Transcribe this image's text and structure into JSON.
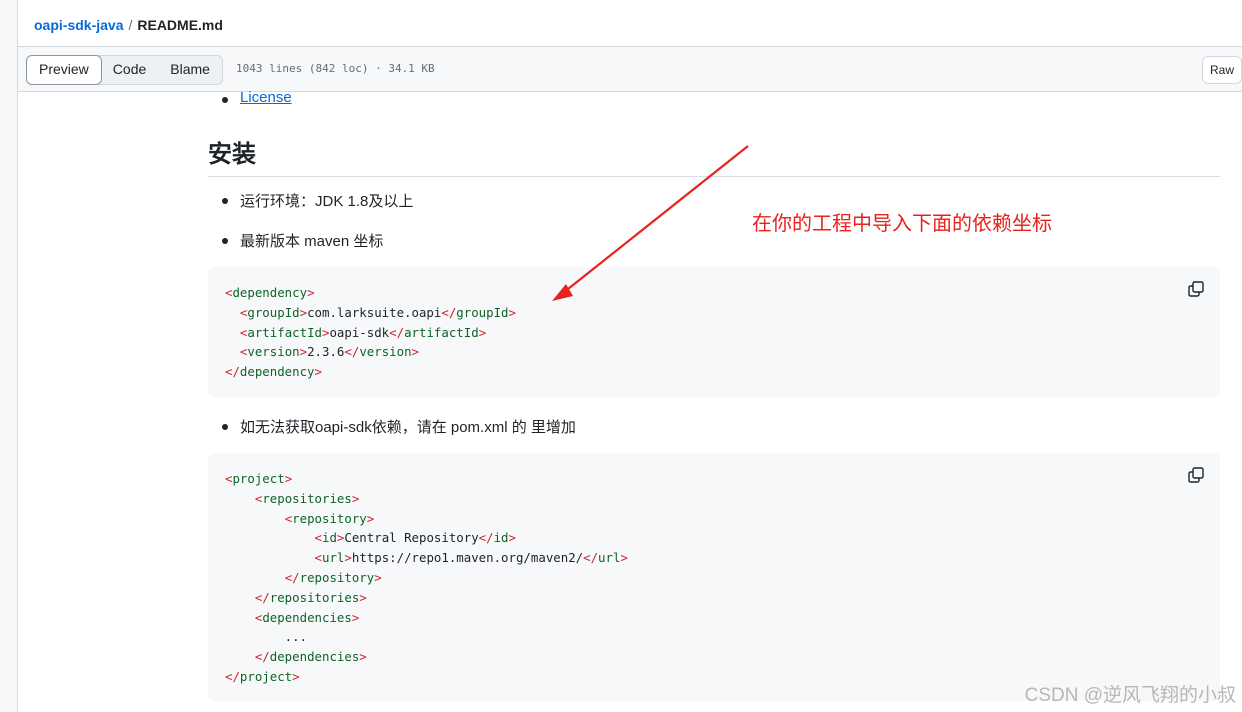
{
  "breadcrumb": {
    "repo": "oapi-sdk-java",
    "separator": "/",
    "file": "README.md"
  },
  "toolbar": {
    "tabs": [
      "Preview",
      "Code",
      "Blame"
    ],
    "active_tab": "Preview",
    "file_info": "1043 lines (842 loc) · 34.1 KB",
    "raw_label": "Raw"
  },
  "content": {
    "license_link": "License",
    "heading": "安装",
    "bullets": [
      "运行环境：JDK 1.8及以上",
      "最新版本 maven 坐标",
      "如无法获取oapi-sdk依赖，请在 pom.xml 的 里增加"
    ],
    "code1_lines": [
      "<dependency>",
      "  <groupId>com.larksuite.oapi</groupId>",
      "  <artifactId>oapi-sdk</artifactId>",
      "  <version>2.3.6</version>",
      "</dependency>"
    ],
    "code2_lines": [
      "<project>",
      "    <repositories>",
      "        <repository>",
      "            <id>Central Repository</id>",
      "            <url>https://repo1.maven.org/maven2/</url>",
      "        </repository>",
      "    </repositories>",
      "    <dependencies>",
      "        ...",
      "    </dependencies>",
      "</project>"
    ]
  },
  "annotation": {
    "text": "在你的工程中导入下面的依赖坐标",
    "color": "#e8231e"
  },
  "watermark": "CSDN @逆风飞翔的小叔",
  "icons": {
    "copy": "copy-icon",
    "arrow": "red-arrow"
  }
}
